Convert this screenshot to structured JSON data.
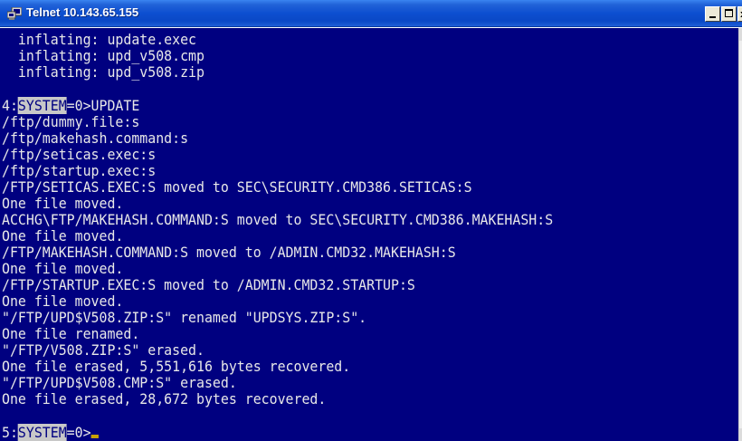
{
  "window": {
    "title": "Telnet 10.143.65.155",
    "icon": "telnet-icon",
    "controls": {
      "minimize": "minimize-icon",
      "maximize": "maximize-icon",
      "close": "close-icon"
    }
  },
  "colors": {
    "terminal_bg": "#000080",
    "terminal_fg": "#e8e8e8",
    "highlight_bg": "#c8c8c8",
    "cursor": "#c8a000",
    "titlebar": "#0a48c6"
  },
  "terminal": {
    "lines": [
      "  inflating: update.exec",
      "  inflating: upd_v508.cmp",
      "  inflating: upd_v508.zip",
      "",
      "4:SYSTEM=0>UPDATE",
      "/ftp/dummy.file:s",
      "/ftp/makehash.command:s",
      "/ftp/seticas.exec:s",
      "/ftp/startup.exec:s",
      "/FTP/SETICAS.EXEC:S moved to SEC\\SECURITY.CMD386.SETICAS:S",
      "One file moved.",
      "ACCHG\\FTP/MAKEHASH.COMMAND:S moved to SEC\\SECURITY.CMD386.MAKEHASH:S",
      "One file moved.",
      "/FTP/MAKEHASH.COMMAND:S moved to /ADMIN.CMD32.MAKEHASH:S",
      "One file moved.",
      "/FTP/STARTUP.EXEC:S moved to /ADMIN.CMD32.STARTUP:S",
      "One file moved.",
      "\"/FTP/UPD$V508.ZIP:S\" renamed \"UPDSYS.ZIP:S\".",
      "One file renamed.",
      "\"/FTP/V508.ZIP:S\" erased.",
      "One file erased, 5,551,616 bytes recovered.",
      "\"/FTP/UPD$V508.CMP:S\" erased.",
      "One file erased, 28,672 bytes recovered.",
      "",
      "5:SYSTEM=0>"
    ],
    "prompt_4": {
      "prefix": "4:",
      "highlight": "SYSTEM",
      "suffix": "=0>UPDATE"
    },
    "prompt_5": {
      "prefix": "5:",
      "highlight": "SYSTEM",
      "suffix": "=0>"
    }
  }
}
